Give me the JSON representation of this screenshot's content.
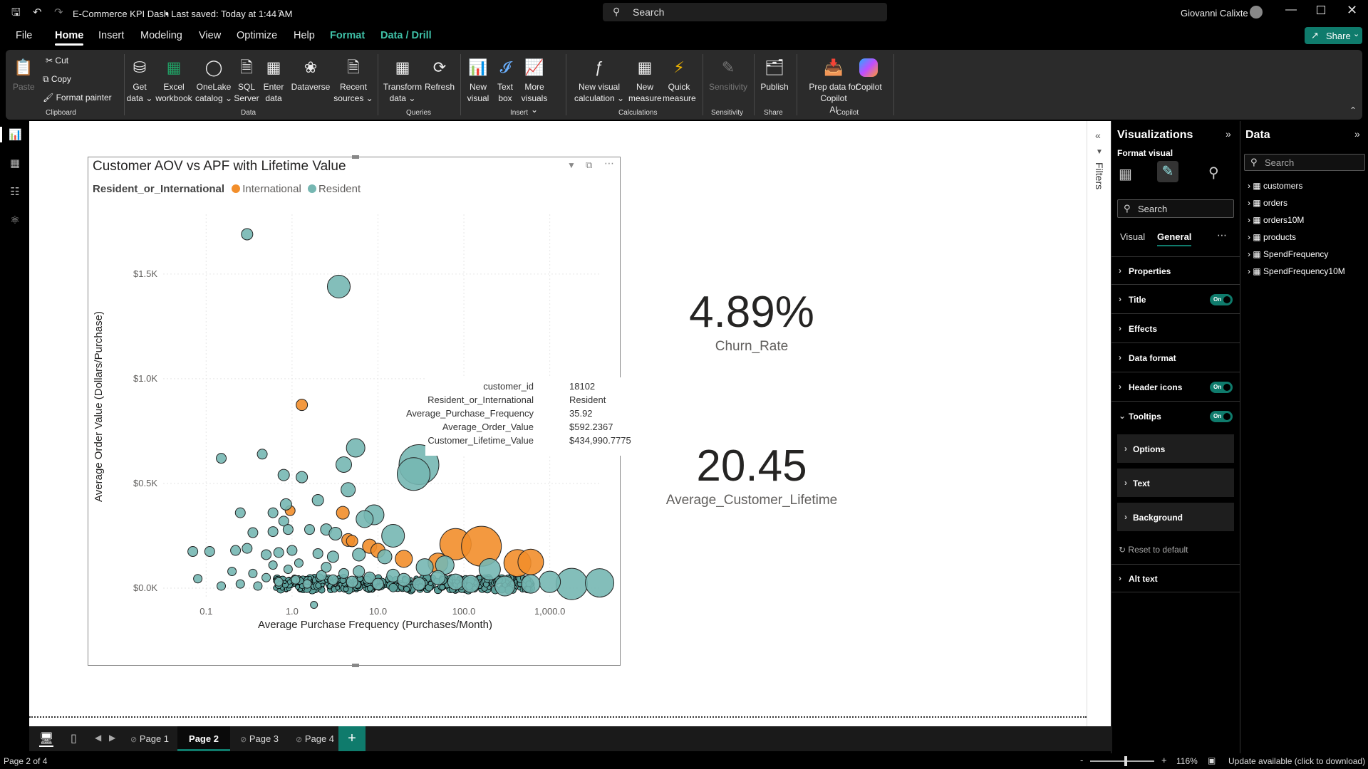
{
  "titlebar": {
    "app_title": "E-Commerce KPI Dash",
    "saved_status": "• Last saved: Today at 1:44 AM",
    "search_placeholder": "Search",
    "user_name": "Giovanni Calixte"
  },
  "menu": {
    "file": "File",
    "home": "Home",
    "insert": "Insert",
    "modeling": "Modeling",
    "view": "View",
    "optimize": "Optimize",
    "help": "Help",
    "format": "Format",
    "data_drill": "Data / Drill",
    "share": "Share"
  },
  "ribbon": {
    "paste": "Paste",
    "cut": "Cut",
    "copy": "Copy",
    "format_painter": "Format painter",
    "get_data_1": "Get",
    "get_data_2": "data ⌄",
    "excel_1": "Excel",
    "excel_2": "workbook",
    "onelake_1": "OneLake",
    "onelake_2": "catalog ⌄",
    "sql_1": "SQL",
    "sql_2": "Server",
    "enter_1": "Enter",
    "enter_2": "data",
    "dataverse": "Dataverse",
    "recent_1": "Recent",
    "recent_2": "sources ⌄",
    "transform_1": "Transform",
    "transform_2": "data ⌄",
    "refresh": "Refresh",
    "new_visual_1": "New",
    "new_visual_2": "visual",
    "text_box_1": "Text",
    "text_box_2": "box",
    "more_visuals_1": "More",
    "more_visuals_2": "visuals ⌄",
    "new_calc_1": "New visual",
    "new_calc_2": "calculation ⌄",
    "new_measure_1": "New",
    "new_measure_2": "measure",
    "quick_measure_1": "Quick",
    "quick_measure_2": "measure",
    "sensitivity": "Sensitivity",
    "publish": "Publish",
    "prep_1": "Prep data for Copilot",
    "prep_2": "AI",
    "copilot": "Copilot",
    "groups": {
      "clipboard": "Clipboard",
      "data": "Data",
      "queries": "Queries",
      "insert": "Insert",
      "calculations": "Calculations",
      "sensitivity": "Sensitivity",
      "share": "Share",
      "copilot": "Copilot"
    }
  },
  "visual": {
    "title": "Customer AOV vs APF with Lifetime Value",
    "legend_title": "Resident_or_International",
    "legend_items": [
      "International",
      "Resident"
    ],
    "colors": {
      "international": "#f28e2b",
      "resident": "#76b7b2"
    }
  },
  "chart_data": {
    "type": "scatter",
    "title": "Customer AOV vs APF with Lifetime Value",
    "xlabel": "Average Purchase Frequency (Purchases/Month)",
    "ylabel": "Average Order Value (Dollars/Purchase)",
    "x_scale": "log",
    "xticks": [
      "0.1",
      "1.0",
      "10.0",
      "100.0",
      "1,000.0"
    ],
    "yticks": [
      "$0.0K",
      "$0.5K",
      "$1.0K",
      "$1.5K"
    ],
    "ylim": [
      0,
      1700
    ],
    "grid": true,
    "legend": "top-left",
    "series": [
      {
        "name": "International",
        "color": "#f28e2b",
        "points": [
          [
            1.3,
            875,
            8
          ],
          [
            0.95,
            370,
            7
          ],
          [
            3.9,
            360,
            9
          ],
          [
            4.5,
            230,
            9
          ],
          [
            5,
            225,
            8
          ],
          [
            8,
            200,
            10
          ],
          [
            10,
            180,
            10
          ],
          [
            80,
            210,
            22
          ],
          [
            160,
            200,
            28
          ],
          [
            420,
            120,
            19
          ],
          [
            600,
            125,
            18
          ],
          [
            20,
            140,
            12
          ],
          [
            50,
            120,
            14
          ]
        ]
      },
      {
        "name": "Resident",
        "color": "#76b7b2",
        "points": [
          [
            0.3,
            1690,
            8
          ],
          [
            3.5,
            1440,
            16
          ],
          [
            0.15,
            620,
            7
          ],
          [
            0.45,
            640,
            7
          ],
          [
            5.5,
            670,
            13
          ],
          [
            30,
            590,
            28
          ],
          [
            26,
            545,
            23
          ],
          [
            4,
            590,
            11
          ],
          [
            0.8,
            540,
            8
          ],
          [
            1.3,
            530,
            8
          ],
          [
            4.5,
            470,
            10
          ],
          [
            2,
            420,
            8
          ],
          [
            0.85,
            400,
            8
          ],
          [
            9,
            350,
            14
          ],
          [
            7,
            330,
            12
          ],
          [
            0.25,
            360,
            7
          ],
          [
            0.6,
            360,
            7
          ],
          [
            0.8,
            320,
            7
          ],
          [
            0.9,
            280,
            7
          ],
          [
            0.35,
            265,
            7
          ],
          [
            0.6,
            270,
            7
          ],
          [
            1.6,
            280,
            7
          ],
          [
            2.5,
            280,
            8
          ],
          [
            3.2,
            260,
            9
          ],
          [
            15,
            250,
            16
          ],
          [
            0.07,
            175,
            7
          ],
          [
            0.11,
            175,
            7
          ],
          [
            0.22,
            180,
            7
          ],
          [
            0.3,
            190,
            7
          ],
          [
            0.5,
            160,
            7
          ],
          [
            0.7,
            170,
            7
          ],
          [
            1,
            180,
            7
          ],
          [
            2,
            165,
            7
          ],
          [
            3,
            150,
            8
          ],
          [
            6,
            160,
            9
          ],
          [
            12,
            150,
            10
          ],
          [
            35,
            100,
            12
          ],
          [
            60,
            110,
            13
          ],
          [
            200,
            90,
            15
          ],
          [
            1800,
            20,
            22
          ],
          [
            3800,
            25,
            20
          ],
          [
            1000,
            30,
            15
          ],
          [
            600,
            20,
            13
          ],
          [
            0.08,
            45,
            6
          ],
          [
            0.15,
            10,
            6
          ],
          [
            0.2,
            80,
            6
          ],
          [
            0.25,
            20,
            6
          ],
          [
            0.35,
            70,
            6
          ],
          [
            0.4,
            10,
            6
          ],
          [
            0.5,
            50,
            6
          ],
          [
            0.6,
            110,
            6
          ],
          [
            0.7,
            30,
            6
          ],
          [
            0.9,
            90,
            6
          ],
          [
            1.1,
            40,
            6
          ],
          [
            1.2,
            120,
            6
          ],
          [
            1.5,
            20,
            6
          ],
          [
            1.8,
            -80,
            5
          ],
          [
            2.2,
            60,
            7
          ],
          [
            2.5,
            100,
            7
          ],
          [
            3,
            40,
            7
          ],
          [
            4,
            70,
            7
          ],
          [
            5,
            30,
            8
          ],
          [
            6,
            80,
            8
          ],
          [
            8,
            50,
            8
          ],
          [
            10,
            20,
            8
          ],
          [
            15,
            60,
            9
          ],
          [
            20,
            40,
            9
          ],
          [
            30,
            20,
            9
          ],
          [
            50,
            50,
            10
          ],
          [
            80,
            30,
            11
          ],
          [
            120,
            20,
            12
          ],
          [
            300,
            10,
            14
          ]
        ]
      }
    ]
  },
  "cards": {
    "churn_value": "4.89%",
    "churn_label": "Churn_Rate",
    "lifetime_value": "20.45",
    "lifetime_label": "Average_Customer_Lifetime"
  },
  "tooltip": {
    "rows": [
      {
        "k": "customer_id",
        "v": "18102"
      },
      {
        "k": "Resident_or_International",
        "v": "Resident"
      },
      {
        "k": "Average_Purchase_Frequency",
        "v": "35.92"
      },
      {
        "k": "Average_Order_Value",
        "v": "$592.2367"
      },
      {
        "k": "Customer_Lifetime_Value",
        "v": "$434,990.7775"
      }
    ]
  },
  "filters_label": "Filters",
  "viz_pane": {
    "title": "Visualizations",
    "format_visual": "Format visual",
    "search_placeholder": "Search",
    "tab_visual": "Visual",
    "tab_general": "General",
    "sections": [
      "Properties",
      "Title",
      "Effects",
      "Data format",
      "Header icons",
      "Tooltips"
    ],
    "toggle_label": "On",
    "sub_sections": [
      "Options",
      "Text",
      "Background"
    ],
    "reset": "Reset to default",
    "alt_text": "Alt text"
  },
  "data_pane": {
    "title": "Data",
    "search_placeholder": "Search",
    "tables": [
      "customers",
      "orders",
      "orders10M",
      "products",
      "SpendFrequency",
      "SpendFrequency10M"
    ]
  },
  "tabs": [
    "Page 1",
    "Page 2",
    "Page 3",
    "Page 4"
  ],
  "status": {
    "page_info": "Page 2 of 4",
    "zoom": "116%",
    "update": "Update available (click to download)"
  }
}
